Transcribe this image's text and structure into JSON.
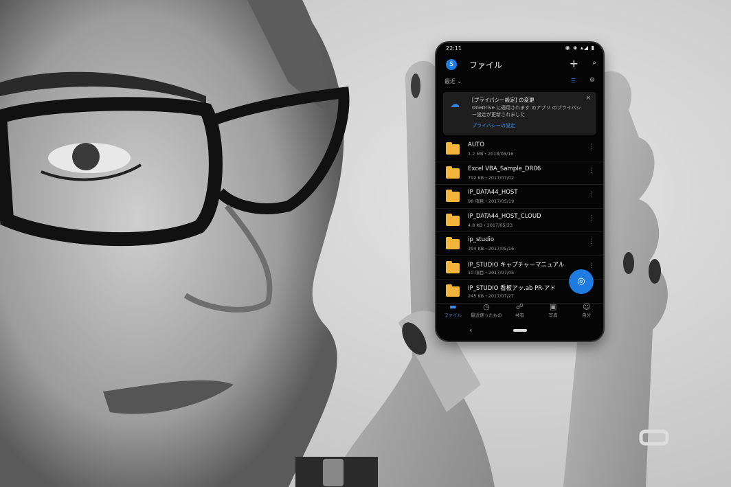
{
  "status": {
    "time": "22:11",
    "icons": "◉ ◈ ▴◢ ▮"
  },
  "app": {
    "avatar": "S",
    "title": "ファイル",
    "plus": "+",
    "search_icon": "search-icon"
  },
  "sort": {
    "label": "最近 ⌄"
  },
  "banner": {
    "title": "[プライバシー設定] の変更",
    "text": "OneDrive に適用されます  のアプリ  のプライバシー設定が更新されました",
    "link": "プライバシーの設定",
    "close": "×"
  },
  "files": [
    {
      "name": "AUTO",
      "meta": "1.2 MB・2018/08/16"
    },
    {
      "name": "Excel VBA_Sample_DR06",
      "meta": "792 KB・2017/07/02"
    },
    {
      "name": "IP_DATA44_HOST",
      "meta": "98 項目・2017/05/19"
    },
    {
      "name": "IP_DATA44_HOST_CLOUD",
      "meta": "4.8 KB・2017/05/23"
    },
    {
      "name": "ip_studio",
      "meta": "394 KB・2017/05/16"
    },
    {
      "name": "IP_STUDIO キャプチャーマニュアル",
      "meta": "10 項目・2017/07/05"
    },
    {
      "name": "IP_STUDIO 看板アッ.ab PR-アド",
      "meta": "245 KB・2017/07/27"
    }
  ],
  "nav": [
    {
      "label": "ファイル",
      "icon": "▬"
    },
    {
      "label": "最近使ったもの",
      "icon": "◷"
    },
    {
      "label": "共有",
      "icon": "☍"
    },
    {
      "label": "写真",
      "icon": "▣"
    },
    {
      "label": "自分",
      "icon": "☺"
    }
  ],
  "fab_icon": "◎",
  "colors": {
    "accent": "#1e7be0",
    "folder": "#f2b53a",
    "phone_bg": "#050505"
  }
}
